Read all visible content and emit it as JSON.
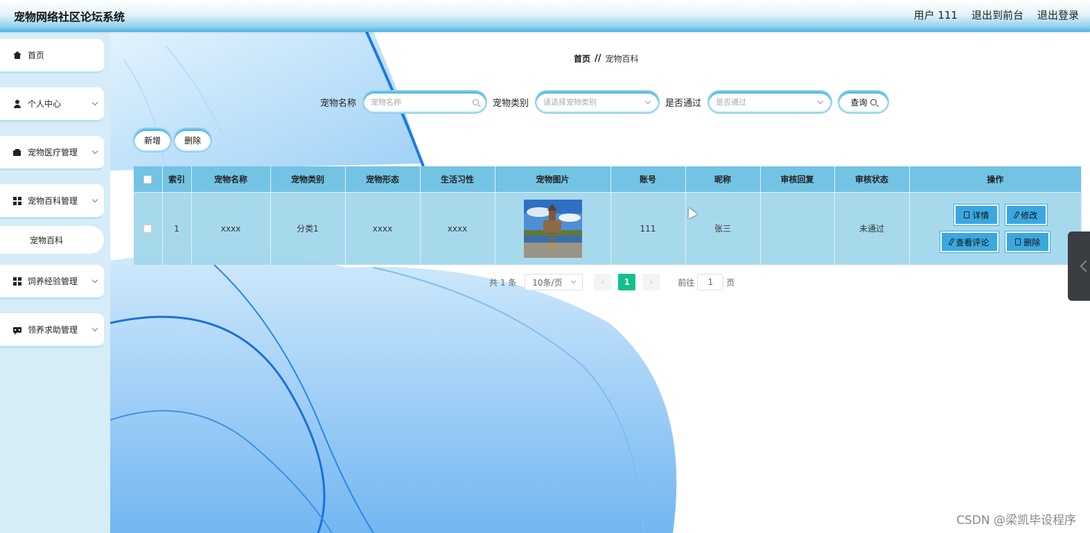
{
  "header": {
    "title": "宠物网络社区论坛系统",
    "user": "用户 111",
    "exit_front": "退出到前台",
    "logout": "退出登录"
  },
  "sidebar": {
    "items": [
      {
        "label": "首页",
        "icon": "home-icon",
        "expandable": false
      },
      {
        "label": "个人中心",
        "icon": "user-icon",
        "expandable": true
      },
      {
        "label": "宠物医疗管理",
        "icon": "wallet-icon",
        "expandable": true
      },
      {
        "label": "宠物百科管理",
        "icon": "grid-icon",
        "expandable": true
      },
      {
        "label": "饲养经验管理",
        "icon": "grid-icon",
        "expandable": true
      },
      {
        "label": "领养求助管理",
        "icon": "chat-icon",
        "expandable": true
      }
    ],
    "sub_item": "宠物百科"
  },
  "breadcrumb": {
    "home": "首页",
    "separator": "//",
    "current": "宠物百科"
  },
  "search": {
    "name_label": "宠物名称",
    "name_placeholder": "宠物名称",
    "category_label": "宠物类别",
    "category_placeholder": "请选择宠物类别",
    "approved_label": "是否通过",
    "approved_placeholder": "是否通过",
    "query_button": "查询"
  },
  "actions": {
    "add": "新增",
    "delete": "删除"
  },
  "table": {
    "headers": [
      "索引",
      "宠物名称",
      "宠物类别",
      "宠物形态",
      "生活习性",
      "宠物图片",
      "账号",
      "昵称",
      "审核回复",
      "审核状态",
      "操作"
    ],
    "rows": [
      {
        "index": "1",
        "name": "xxxx",
        "category": "分类1",
        "form": "xxxx",
        "habit": "xxxx",
        "account": "111",
        "nickname": "张三",
        "reply": "",
        "status": "未通过"
      }
    ],
    "ops": {
      "detail": "详情",
      "edit": "修改",
      "comments": "查看评论",
      "delete": "删除"
    }
  },
  "pagination": {
    "total": "共 1 条",
    "page_size": "10条/页",
    "current": "1",
    "goto_label": "前往",
    "goto_value": "1",
    "page_suffix": "页",
    "prev": "‹",
    "next": "›"
  },
  "watermark": "CSDN @梁凯毕设程序",
  "colors": {
    "accent": "#3aa8e0",
    "header_blue": "#49b3e4",
    "table_header": "#73c3e4",
    "pager_active": "#13c08b",
    "sidebar_bg": "#d6edf7"
  }
}
